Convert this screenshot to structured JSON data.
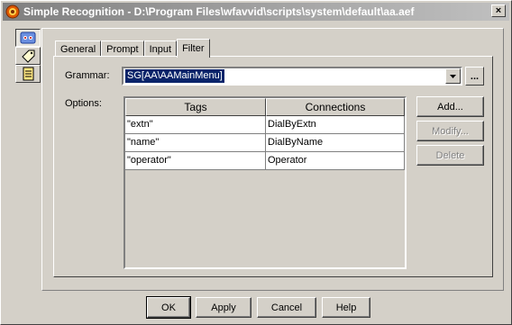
{
  "window": {
    "title": "Simple Recognition - D:\\Program Files\\wfavvid\\scripts\\system\\default\\aa.aef",
    "close_label": "×"
  },
  "side_tabs": [
    {
      "icon": "recognition-icon"
    },
    {
      "icon": "tag-icon"
    },
    {
      "icon": "notes-icon"
    }
  ],
  "tabs": [
    {
      "label": "General"
    },
    {
      "label": "Prompt"
    },
    {
      "label": "Input"
    },
    {
      "label": "Filter"
    }
  ],
  "grammar": {
    "label": "Grammar:",
    "value": "SG[AA\\AAMainMenu]",
    "browse_label": "..."
  },
  "options": {
    "label": "Options:",
    "columns": [
      "Tags",
      "Connections"
    ],
    "rows": [
      {
        "tag": "\"extn\"",
        "connection": "DialByExtn"
      },
      {
        "tag": "\"name\"",
        "connection": "DialByName"
      },
      {
        "tag": "\"operator\"",
        "connection": "Operator"
      }
    ]
  },
  "side_buttons": {
    "add": "Add...",
    "modify": "Modify...",
    "delete": "Delete"
  },
  "footer": {
    "ok": "OK",
    "apply": "Apply",
    "cancel": "Cancel",
    "help": "Help"
  }
}
